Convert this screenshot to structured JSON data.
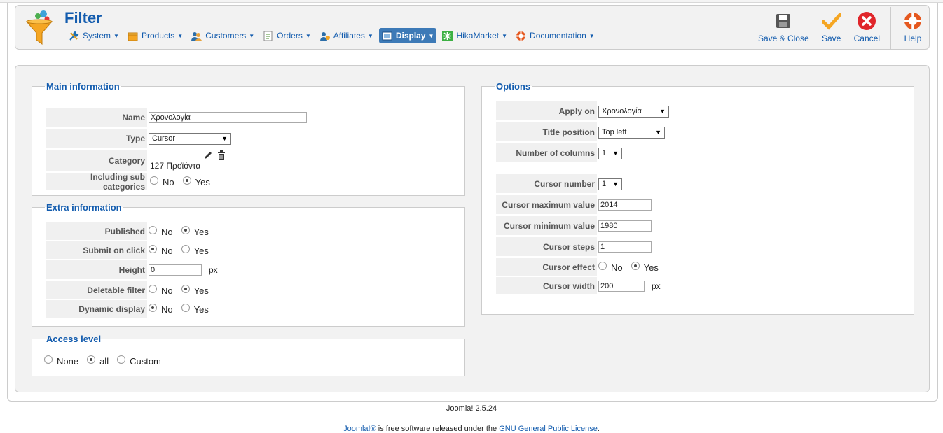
{
  "header": {
    "title": "Filter",
    "menu": [
      {
        "label": "System",
        "icon": "wrench-icon",
        "color": "#1a6fb5"
      },
      {
        "label": "Products",
        "icon": "box-icon",
        "color": "#f5a623"
      },
      {
        "label": "Customers",
        "icon": "users-icon",
        "color": "#2c6ea8"
      },
      {
        "label": "Orders",
        "icon": "orders-icon",
        "color": "#4a8f2c"
      },
      {
        "label": "Affiliates",
        "icon": "affiliates-icon",
        "color": "#2c6ea8"
      },
      {
        "label": "Display",
        "icon": "display-icon",
        "color": "#ffffff"
      },
      {
        "label": "HikaMarket",
        "icon": "hikamarket-icon",
        "color": "#3cb043"
      },
      {
        "label": "Documentation",
        "icon": "lifebuoy-icon",
        "color": "#e5581f"
      }
    ],
    "toolbar": {
      "save_close": "Save & Close",
      "save": "Save",
      "cancel": "Cancel",
      "help": "Help"
    }
  },
  "main_info": {
    "legend": "Main information",
    "name_label": "Name",
    "name_value": "Χρονολογία",
    "type_label": "Type",
    "type_value": "Cursor",
    "category_label": "Category",
    "category_value": "127 Προϊόντα",
    "subcat_label": "Including sub categories",
    "no": "No",
    "yes": "Yes"
  },
  "extra_info": {
    "legend": "Extra information",
    "published_label": "Published",
    "submit_label": "Submit on click",
    "height_label": "Height",
    "height_value": "0",
    "px": "px",
    "deletable_label": "Deletable filter",
    "dynamic_label": "Dynamic display",
    "no": "No",
    "yes": "Yes"
  },
  "access": {
    "legend": "Access level",
    "none": "None",
    "all": "all",
    "custom": "Custom"
  },
  "options": {
    "legend": "Options",
    "apply_label": "Apply on",
    "apply_value": "Χρονολογία",
    "title_pos_label": "Title position",
    "title_pos_value": "Top left",
    "columns_label": "Number of columns",
    "columns_value": "1",
    "cursor_number_label": "Cursor number",
    "cursor_number_value": "1",
    "cursor_max_label": "Cursor maximum value",
    "cursor_max_value": "2014",
    "cursor_min_label": "Cursor minimum value",
    "cursor_min_value": "1980",
    "cursor_steps_label": "Cursor steps",
    "cursor_steps_value": "1",
    "cursor_effect_label": "Cursor effect",
    "cursor_width_label": "Cursor width",
    "cursor_width_value": "200",
    "px": "px",
    "no": "No",
    "yes": "Yes"
  },
  "footer": {
    "version": "Joomla! 2.5.24",
    "joomla_link": "Joomla!®",
    "mid_text": " is free software released under the ",
    "license_link": "GNU General Public License",
    "end": "."
  }
}
